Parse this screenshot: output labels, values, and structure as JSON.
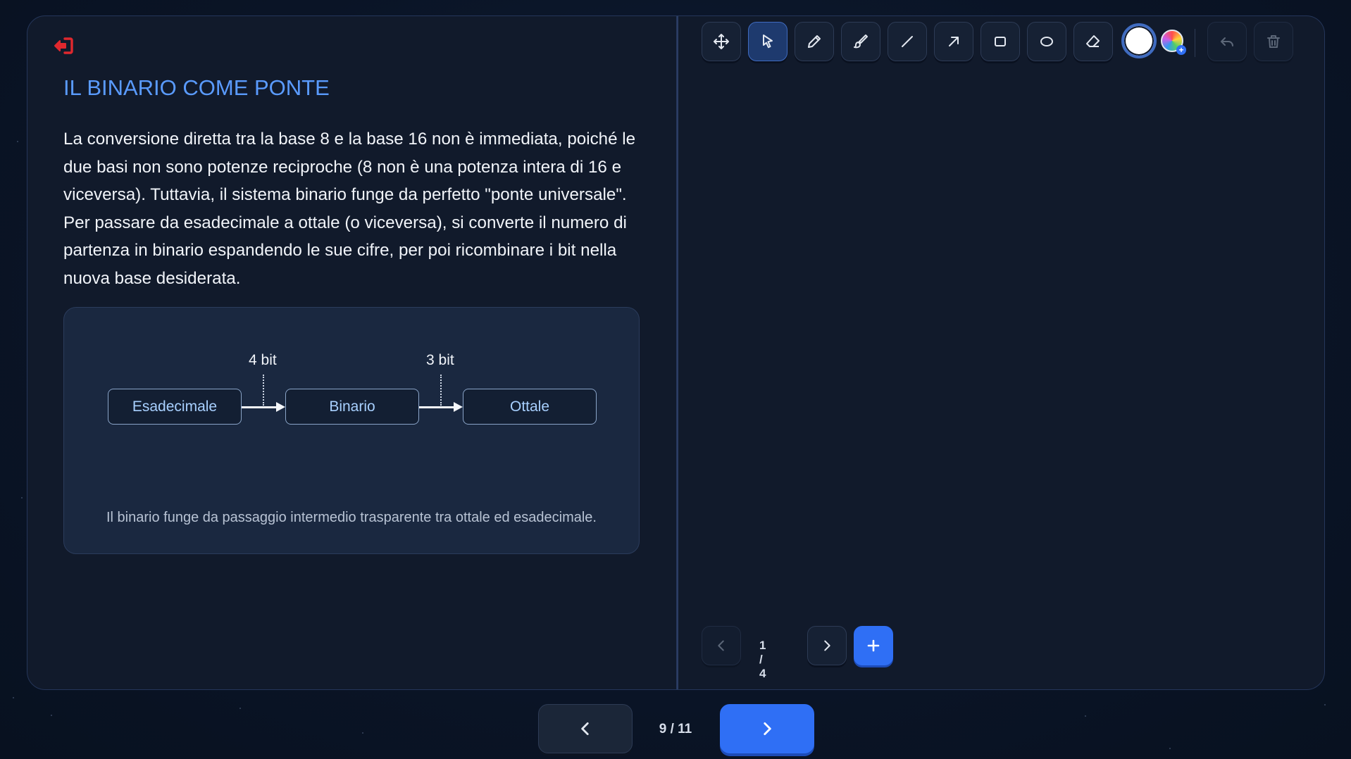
{
  "slide": {
    "title": "IL BINARIO COME PONTE",
    "body": "La conversione diretta tra la base 8 e la base 16 non è immediata, poiché le due basi non sono potenze reciproche (8 non è una potenza intera di 16 e viceversa). Tuttavia, il sistema binario funge da perfetto \"ponte universale\". Per passare da esadecimale a ottale (o viceversa), si converte il numero di partenza in binario espandendo le sue cifre, per poi ricombinare i bit nella nuova base desiderata."
  },
  "diagram": {
    "nodes": [
      "Esadecimale",
      "Binario",
      "Ottale"
    ],
    "connectors": [
      "4 bit",
      "3 bit"
    ],
    "caption": "Il binario funge da passaggio intermedio trasparente tra ottale ed esadecimale."
  },
  "whiteboard": {
    "tools": [
      "move-icon",
      "pointer-icon",
      "pencil-icon",
      "brush-icon",
      "line-icon",
      "arrow-icon",
      "rectangle-icon",
      "ellipse-icon",
      "eraser-icon"
    ],
    "active_tool": "pointer-icon",
    "current_color": "#ffffff",
    "page_indicator": "1 / 4"
  },
  "navigation": {
    "slide_indicator": "9 / 11"
  },
  "colors": {
    "accent": "#2f6ff5",
    "title": "#5a9bff",
    "exit": "#e0282e"
  }
}
